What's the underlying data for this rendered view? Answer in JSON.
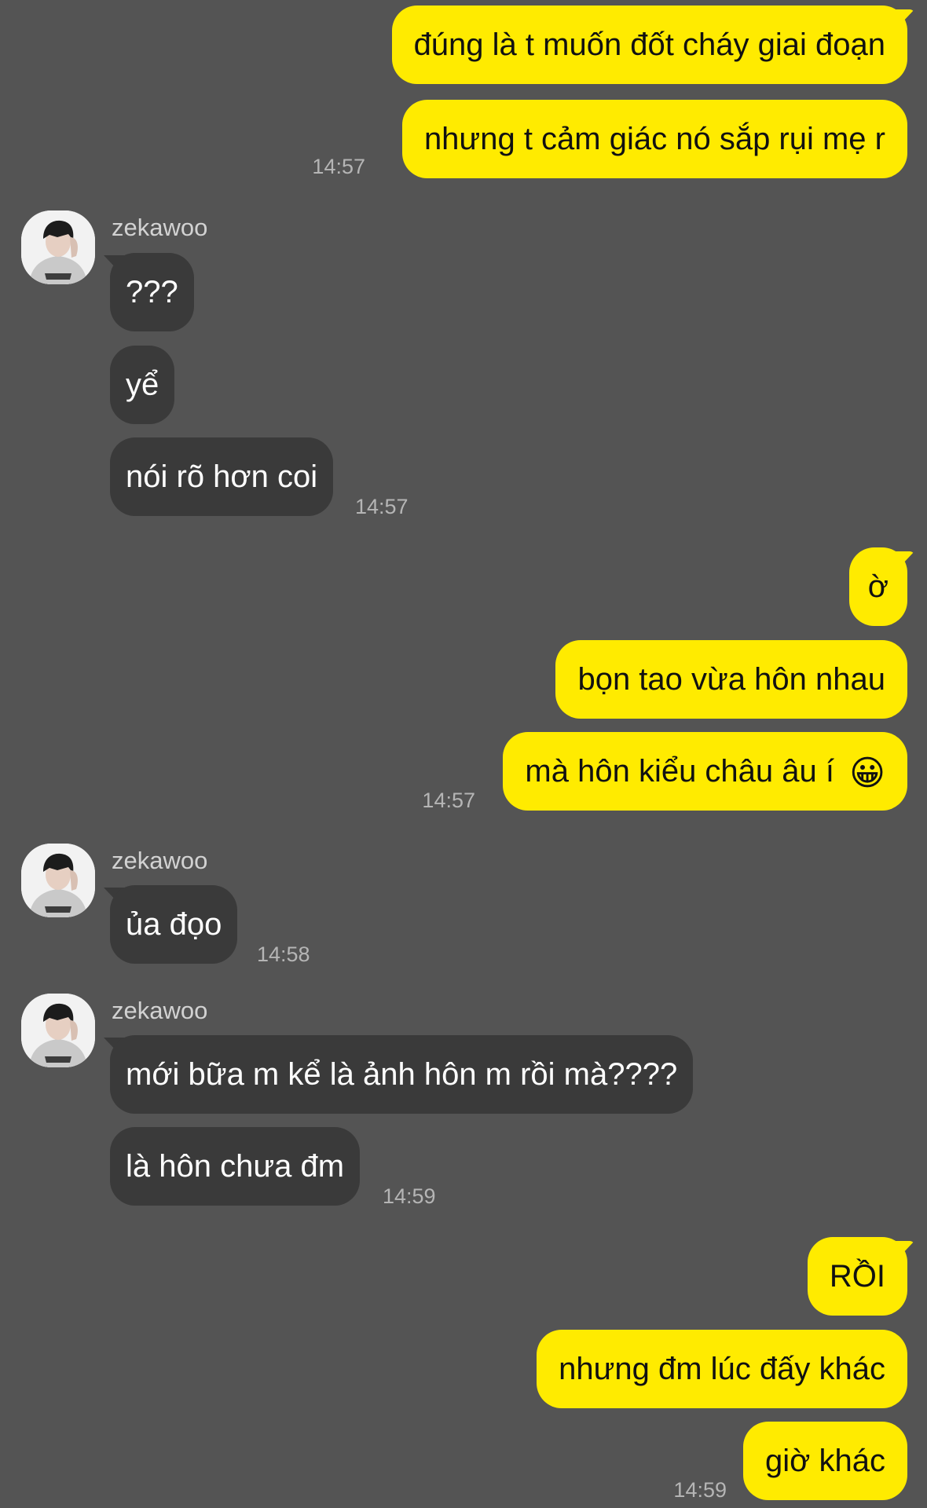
{
  "contact": {
    "name": "zekawoo"
  },
  "icons": {
    "avatar": "profile-photo",
    "emoji": "grinning-face-emoji"
  },
  "colors": {
    "background": "#545454",
    "outgoing_bubble": "#ffeb00",
    "incoming_bubble": "#3a3a3a",
    "timestamp": "#b5b5b5"
  },
  "messages": [
    {
      "direction": "out",
      "text": "đúng là t muốn đốt cháy giai đoạn"
    },
    {
      "direction": "out",
      "text": "nhưng t cảm giác nó sắp rụi mẹ r",
      "time": "14:57"
    },
    {
      "direction": "in",
      "sender": "zekawoo",
      "text": "???"
    },
    {
      "direction": "in",
      "text": "yể"
    },
    {
      "direction": "in",
      "text": "nói rõ hơn coi",
      "time": "14:57"
    },
    {
      "direction": "out",
      "text": "ờ"
    },
    {
      "direction": "out",
      "text": "bọn tao vừa hôn nhau"
    },
    {
      "direction": "out",
      "text": "mà hôn kiểu châu âu í",
      "emoji": "😀",
      "time": "14:57"
    },
    {
      "direction": "in",
      "sender": "zekawoo",
      "text": "ủa đọo",
      "time": "14:58"
    },
    {
      "direction": "in",
      "sender": "zekawoo",
      "text": "mới bữa m kể là ảnh hôn m rồi mà????"
    },
    {
      "direction": "in",
      "text": "là hôn chưa đm",
      "time": "14:59"
    },
    {
      "direction": "out",
      "text": "RỒI"
    },
    {
      "direction": "out",
      "text": "nhưng đm lúc đấy khác"
    },
    {
      "direction": "out",
      "text": "giờ khác",
      "time": "14:59"
    }
  ]
}
